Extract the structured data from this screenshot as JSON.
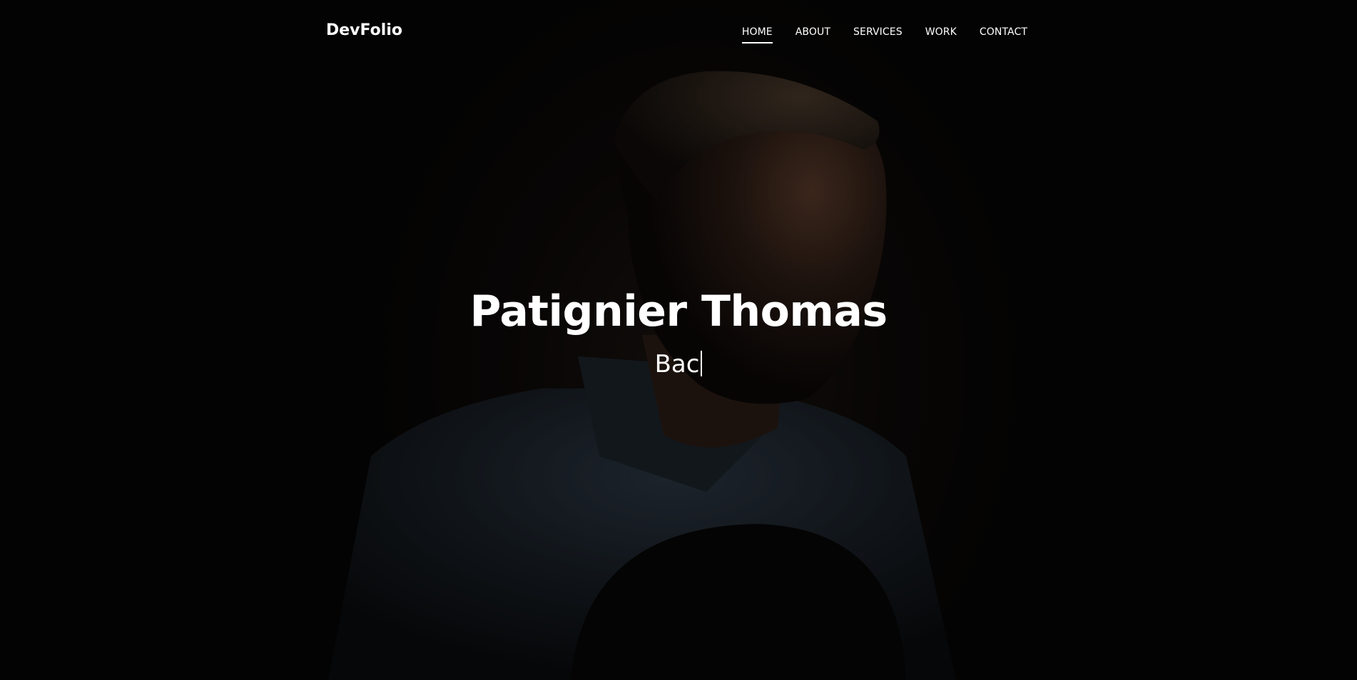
{
  "site": {
    "brand": "DevFolio"
  },
  "nav": {
    "items": [
      {
        "label": "HOME",
        "active": true
      },
      {
        "label": "ABOUT",
        "active": false
      },
      {
        "label": "SERVICES",
        "active": false
      },
      {
        "label": "WORK",
        "active": false
      },
      {
        "label": "CONTACT",
        "active": false
      }
    ]
  },
  "intro": {
    "title": "Patignier Thomas",
    "subtitle": "Bac"
  },
  "colors": {
    "background": "#050505",
    "text": "#ffffff"
  },
  "hero_image": {
    "icon": "portrait-photo"
  }
}
